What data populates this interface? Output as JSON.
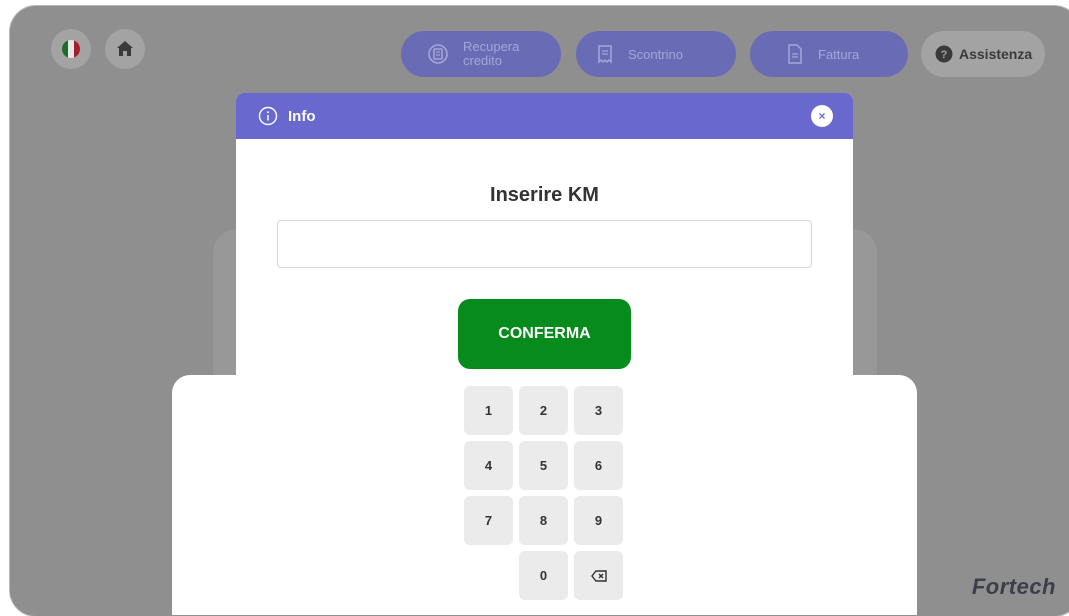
{
  "topbar": {
    "buttons": [
      {
        "label_line1": "Recupera",
        "label_line2": "credito",
        "icon": "refresh-receipt-icon"
      },
      {
        "label": "Scontrino",
        "icon": "receipt-icon"
      },
      {
        "label": "Fattura",
        "icon": "invoice-icon"
      },
      {
        "label": "Assistenza",
        "icon": "help-icon"
      }
    ],
    "language_flag": "italian-flag-icon",
    "home": "home-icon"
  },
  "modal": {
    "title": "Info",
    "heading": "Inserire KM",
    "input_value": "",
    "confirm_label": "CONFERMA",
    "close_symbol": "×"
  },
  "keypad": {
    "keys": [
      "1",
      "2",
      "3",
      "4",
      "5",
      "6",
      "7",
      "8",
      "9",
      "0"
    ],
    "backspace_symbol": "⌫"
  },
  "brand": "Fortech",
  "colors": {
    "header": "#6868cf",
    "confirm": "#068b1c",
    "pill": "#6a6bb5"
  }
}
